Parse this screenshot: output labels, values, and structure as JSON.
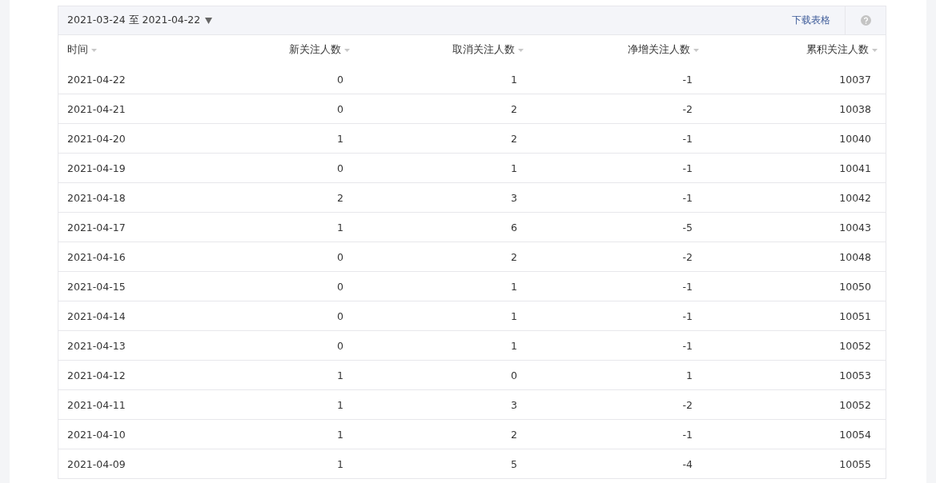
{
  "toolbar": {
    "date_range": "2021-03-24 至 2021-04-22",
    "download_link": "下载表格"
  },
  "table": {
    "columns": [
      "时间",
      "新关注人数",
      "取消关注人数",
      "净增关注人数",
      "累积关注人数"
    ],
    "rows": [
      [
        "2021-04-22",
        "0",
        "1",
        "-1",
        "10037"
      ],
      [
        "2021-04-21",
        "0",
        "2",
        "-2",
        "10038"
      ],
      [
        "2021-04-20",
        "1",
        "2",
        "-1",
        "10040"
      ],
      [
        "2021-04-19",
        "0",
        "1",
        "-1",
        "10041"
      ],
      [
        "2021-04-18",
        "2",
        "3",
        "-1",
        "10042"
      ],
      [
        "2021-04-17",
        "1",
        "6",
        "-5",
        "10043"
      ],
      [
        "2021-04-16",
        "0",
        "2",
        "-2",
        "10048"
      ],
      [
        "2021-04-15",
        "0",
        "1",
        "-1",
        "10050"
      ],
      [
        "2021-04-14",
        "0",
        "1",
        "-1",
        "10051"
      ],
      [
        "2021-04-13",
        "0",
        "1",
        "-1",
        "10052"
      ],
      [
        "2021-04-12",
        "1",
        "0",
        "1",
        "10053"
      ],
      [
        "2021-04-11",
        "1",
        "3",
        "-2",
        "10052"
      ],
      [
        "2021-04-10",
        "1",
        "2",
        "-1",
        "10054"
      ],
      [
        "2021-04-09",
        "1",
        "5",
        "-4",
        "10055"
      ]
    ]
  }
}
